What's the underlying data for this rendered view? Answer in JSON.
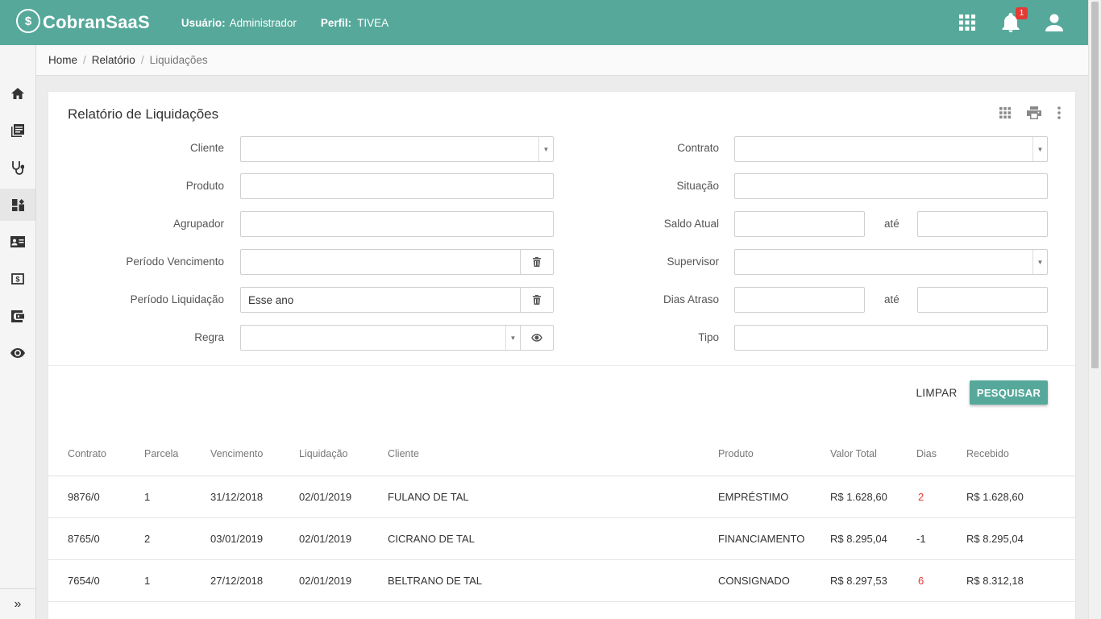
{
  "header": {
    "brand_logo": "$",
    "brand_name": "CobranSaaS",
    "user_label": "Usuário:",
    "user_value": "Administrador",
    "profile_label": "Perfil:",
    "profile_value": "TIVEA",
    "notification_count": "1",
    "accent_color": "#56a99a"
  },
  "sidebar": {
    "items": [
      {
        "icon": "home-icon"
      },
      {
        "icon": "book-icon"
      },
      {
        "icon": "stethoscope-icon"
      },
      {
        "icon": "dashboard-icon"
      },
      {
        "icon": "contact-card-icon"
      },
      {
        "icon": "money-icon"
      },
      {
        "icon": "wallet-icon"
      },
      {
        "icon": "eye-icon"
      }
    ],
    "active_index": 3,
    "expand_glyph": "»"
  },
  "breadcrumb": {
    "home": "Home",
    "section": "Relatório",
    "current": "Liquidações",
    "separator": "/"
  },
  "report": {
    "title": "Relatório de Liquidações",
    "filters": {
      "cliente_label": "Cliente",
      "produto_label": "Produto",
      "agrupador_label": "Agrupador",
      "periodo_vencimento_label": "Período Vencimento",
      "periodo_liquidacao_label": "Período Liquidação",
      "periodo_liquidacao_value": "Esse ano",
      "regra_label": "Regra",
      "contrato_label": "Contrato",
      "situacao_label": "Situação",
      "saldo_atual_label": "Saldo Atual",
      "supervisor_label": "Supervisor",
      "dias_atraso_label": "Dias Atraso",
      "tipo_label": "Tipo",
      "ate_label": "até"
    },
    "actions": {
      "clear_label": "LIMPAR",
      "search_label": "PESQUISAR"
    }
  },
  "table": {
    "columns": [
      "Contrato",
      "Parcela",
      "Vencimento",
      "Liquidação",
      "Cliente",
      "Produto",
      "Valor Total",
      "Dias",
      "Recebido"
    ],
    "rows": [
      {
        "contrato": "9876/0",
        "parcela": "1",
        "vencimento": "31/12/2018",
        "liquidacao": "02/01/2019",
        "cliente": "FULANO DE TAL",
        "produto": "EMPRÉSTIMO",
        "valor_total": "R$ 1.628,60",
        "dias": "2",
        "recebido": "R$ 1.628,60",
        "dias_late": true
      },
      {
        "contrato": "8765/0",
        "parcela": "2",
        "vencimento": "03/01/2019",
        "liquidacao": "02/01/2019",
        "cliente": "CICRANO DE TAL",
        "produto": "FINANCIAMENTO",
        "valor_total": "R$ 8.295,04",
        "dias": "-1",
        "recebido": "R$ 8.295,04",
        "dias_late": false
      },
      {
        "contrato": "7654/0",
        "parcela": "1",
        "vencimento": "27/12/2018",
        "liquidacao": "02/01/2019",
        "cliente": "BELTRANO DE TAL",
        "produto": "CONSIGNADO",
        "valor_total": "R$ 8.297,53",
        "dias": "6",
        "recebido": "R$ 8.312,18",
        "dias_late": true
      }
    ],
    "late_color": "#e53935"
  }
}
